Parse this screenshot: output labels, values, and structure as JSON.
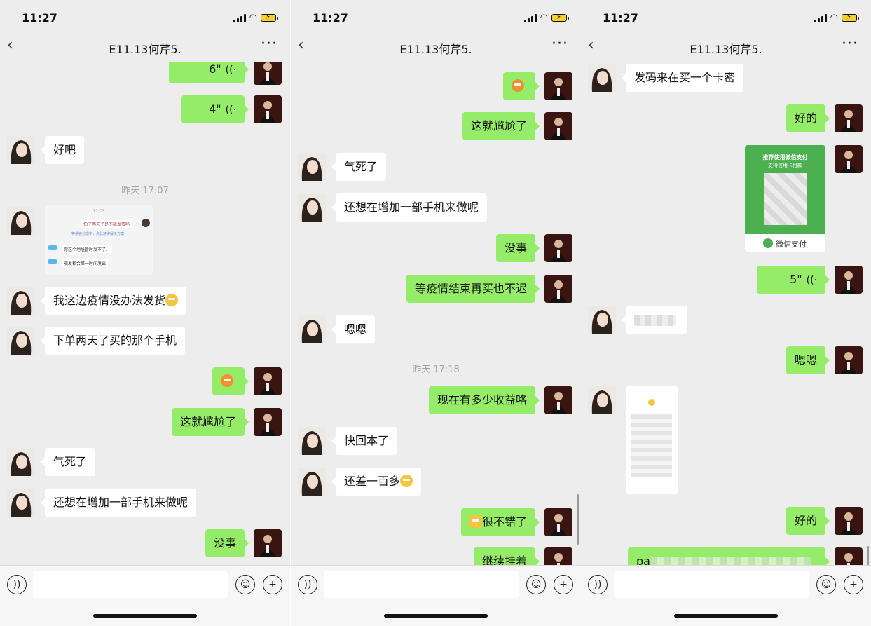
{
  "status": {
    "time": "11:27"
  },
  "nav": {
    "back_icon": "‹",
    "title": "E11.13何芹5.",
    "more_icon": "···"
  },
  "p1": {
    "voice6": "6\"",
    "voice4": "4\"",
    "m_haoba": "好吧",
    "ts1": "昨天 17:07",
    "shot_time": "17:05",
    "shot_line1": "拍了两天了是不能发货吗",
    "shot_line2": "等候被处理中，点此获得解决方案",
    "shot_line3": "你这个地址暂时发不了。",
    "shot_line4": "能发都会第一时间发出",
    "m_yiqing": "我这边疫情没办法发货",
    "m_xiadan": "下单两天了买的那个手机",
    "m_ganga": "这就尴尬了",
    "m_qisi": "气死了",
    "m_haixiang": "还想在增加一部手机来做呢",
    "m_meishi": "没事"
  },
  "p2": {
    "m_ganga": "这就尴尬了",
    "m_qisi": "气死了",
    "m_haixiang": "还想在增加一部手机来做呢",
    "m_meishi": "没事",
    "m_deng": "等疫情结束再买也不迟",
    "m_enen": "嗯嗯",
    "ts": "昨天 17:18",
    "m_shouyi": "现在有多少收益咯",
    "m_kuai": "快回本了",
    "m_haicha": "还差一百多",
    "m_henbucuo": "很不错了",
    "m_jixu": "继续挂着"
  },
  "p3": {
    "m_fama": "发码来在买一个卡密",
    "m_haode": "好的",
    "pay_title": "推荐使用微信支付",
    "pay_sub": "支持信用卡付款",
    "pay_footer": "微信支付",
    "voice5": "5\"",
    "m_enen": "嗯嗯",
    "m_haode2": "好的",
    "m_pa": "pa"
  },
  "input": {
    "voice_icon": "🔊",
    "emoji_icon": "☺",
    "plus_icon": "+"
  },
  "colors": {
    "bg": "#ededed",
    "green_bubble": "#95ec69",
    "white_bubble": "#ffffff",
    "pay_green": "#4caf50"
  }
}
